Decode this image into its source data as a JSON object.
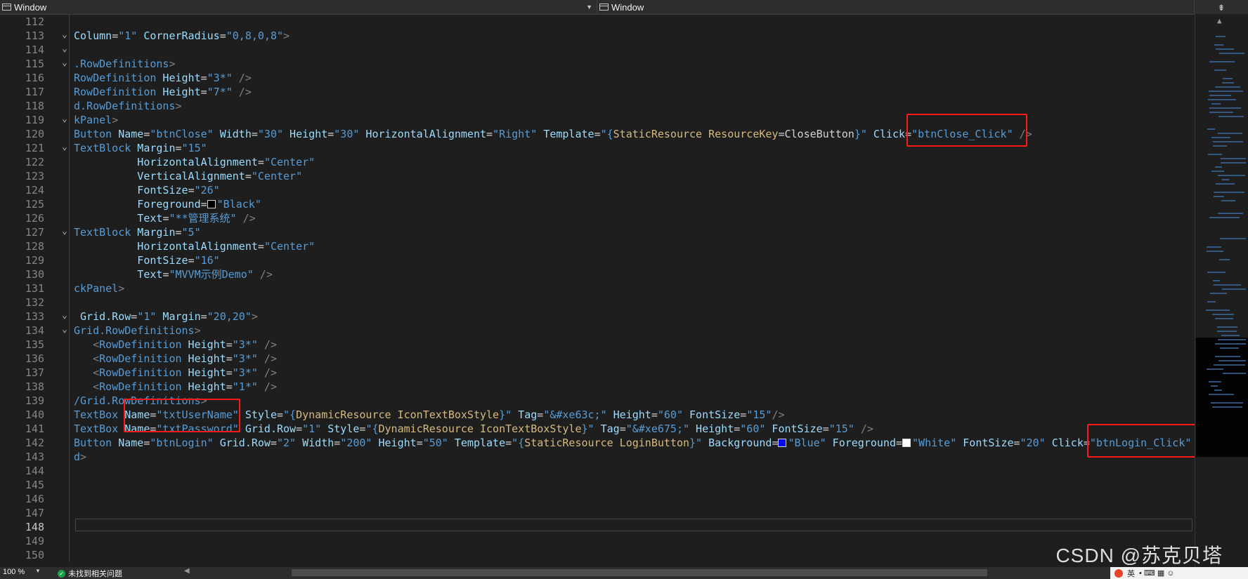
{
  "nav": {
    "left_label": "Window",
    "right_label": "Window",
    "split_glyph": "⇟"
  },
  "editor": {
    "current_line": 148,
    "lines": [
      {
        "n": "112",
        "fold": "",
        "tokens": []
      },
      {
        "n": "113",
        "fold": "⌄",
        "tokens": [
          {
            "t": "Column",
            "c": "t-attr"
          },
          {
            "t": "=",
            "c": "t-op"
          },
          {
            "t": "\"1\"",
            "c": "t-str"
          },
          {
            "t": " CornerRadius",
            "c": "t-attr"
          },
          {
            "t": "=",
            "c": "t-op"
          },
          {
            "t": "\"0,8,0,8\"",
            "c": "t-str"
          },
          {
            "t": ">",
            "c": "t-punc"
          }
        ]
      },
      {
        "n": "114",
        "fold": "⌄",
        "tokens": []
      },
      {
        "n": "115",
        "fold": "⌄",
        "tokens": [
          {
            "t": ".RowDefinitions",
            "c": "t-el"
          },
          {
            "t": ">",
            "c": "t-punc"
          }
        ]
      },
      {
        "n": "116",
        "fold": "",
        "tokens": [
          {
            "t": "RowDefinition",
            "c": "t-el"
          },
          {
            "t": " Height",
            "c": "t-attr"
          },
          {
            "t": "=",
            "c": "t-op"
          },
          {
            "t": "\"3*\"",
            "c": "t-str"
          },
          {
            "t": " />",
            "c": "t-punc"
          }
        ]
      },
      {
        "n": "117",
        "fold": "",
        "tokens": [
          {
            "t": "RowDefinition",
            "c": "t-el"
          },
          {
            "t": " Height",
            "c": "t-attr"
          },
          {
            "t": "=",
            "c": "t-op"
          },
          {
            "t": "\"7*\"",
            "c": "t-str"
          },
          {
            "t": " />",
            "c": "t-punc"
          }
        ]
      },
      {
        "n": "118",
        "fold": "",
        "tokens": [
          {
            "t": "d.RowDefinitions",
            "c": "t-el"
          },
          {
            "t": ">",
            "c": "t-punc"
          }
        ]
      },
      {
        "n": "119",
        "fold": "⌄",
        "tokens": [
          {
            "t": "kPanel",
            "c": "t-el"
          },
          {
            "t": ">",
            "c": "t-punc"
          }
        ]
      },
      {
        "n": "120",
        "fold": "",
        "tokens": [
          {
            "t": "Button",
            "c": "t-el"
          },
          {
            "t": " Name",
            "c": "t-attr"
          },
          {
            "t": "=",
            "c": "t-op"
          },
          {
            "t": "\"btnClose\"",
            "c": "t-str"
          },
          {
            "t": " Width",
            "c": "t-attr"
          },
          {
            "t": "=",
            "c": "t-op"
          },
          {
            "t": "\"30\"",
            "c": "t-str"
          },
          {
            "t": " Height",
            "c": "t-attr"
          },
          {
            "t": "=",
            "c": "t-op"
          },
          {
            "t": "\"30\"",
            "c": "t-str"
          },
          {
            "t": " HorizontalAlignment",
            "c": "t-attr"
          },
          {
            "t": "=",
            "c": "t-op"
          },
          {
            "t": "\"Right\"",
            "c": "t-str"
          },
          {
            "t": " Template",
            "c": "t-attr"
          },
          {
            "t": "=",
            "c": "t-op"
          },
          {
            "t": "\"{",
            "c": "t-str"
          },
          {
            "t": "StaticResource",
            "c": "t-ext"
          },
          {
            "t": " ResourceKey",
            "c": "t-ext"
          },
          {
            "t": "=CloseButton",
            "c": "t-plain"
          },
          {
            "t": "}\"",
            "c": "t-str"
          },
          {
            "t": " Click",
            "c": "t-attr"
          },
          {
            "t": "=",
            "c": "t-op"
          },
          {
            "t": "\"btnClose_Click\"",
            "c": "t-str"
          },
          {
            "t": " />",
            "c": "t-punc"
          }
        ]
      },
      {
        "n": "121",
        "fold": "⌄",
        "tokens": [
          {
            "t": "TextBlock",
            "c": "t-el"
          },
          {
            "t": " Margin",
            "c": "t-attr"
          },
          {
            "t": "=",
            "c": "t-op"
          },
          {
            "t": "\"15\"",
            "c": "t-str"
          }
        ]
      },
      {
        "n": "122",
        "fold": "",
        "tokens": [
          {
            "t": "          HorizontalAlignment",
            "c": "t-attr"
          },
          {
            "t": "=",
            "c": "t-op"
          },
          {
            "t": "\"Center\"",
            "c": "t-str"
          }
        ]
      },
      {
        "n": "123",
        "fold": "",
        "tokens": [
          {
            "t": "          VerticalAlignment",
            "c": "t-attr"
          },
          {
            "t": "=",
            "c": "t-op"
          },
          {
            "t": "\"Center\"",
            "c": "t-str"
          }
        ]
      },
      {
        "n": "124",
        "fold": "",
        "tokens": [
          {
            "t": "          FontSize",
            "c": "t-attr"
          },
          {
            "t": "=",
            "c": "t-op"
          },
          {
            "t": "\"26\"",
            "c": "t-str"
          }
        ]
      },
      {
        "n": "125",
        "fold": "",
        "tokens": [
          {
            "t": "          Foreground",
            "c": "t-attr"
          },
          {
            "t": "=",
            "c": "t-op"
          },
          {
            "swatch": "#000000"
          },
          {
            "t": "\"Black\"",
            "c": "t-str"
          }
        ]
      },
      {
        "n": "126",
        "fold": "",
        "tokens": [
          {
            "t": "          Text",
            "c": "t-attr"
          },
          {
            "t": "=",
            "c": "t-op"
          },
          {
            "t": "\"**管理系统\"",
            "c": "t-str"
          },
          {
            "t": " />",
            "c": "t-punc"
          }
        ]
      },
      {
        "n": "127",
        "fold": "⌄",
        "tokens": [
          {
            "t": "TextBlock",
            "c": "t-el"
          },
          {
            "t": " Margin",
            "c": "t-attr"
          },
          {
            "t": "=",
            "c": "t-op"
          },
          {
            "t": "\"5\"",
            "c": "t-str"
          }
        ]
      },
      {
        "n": "128",
        "fold": "",
        "tokens": [
          {
            "t": "          HorizontalAlignment",
            "c": "t-attr"
          },
          {
            "t": "=",
            "c": "t-op"
          },
          {
            "t": "\"Center\"",
            "c": "t-str"
          }
        ]
      },
      {
        "n": "129",
        "fold": "",
        "tokens": [
          {
            "t": "          FontSize",
            "c": "t-attr"
          },
          {
            "t": "=",
            "c": "t-op"
          },
          {
            "t": "\"16\"",
            "c": "t-str"
          }
        ]
      },
      {
        "n": "130",
        "fold": "",
        "tokens": [
          {
            "t": "          Text",
            "c": "t-attr"
          },
          {
            "t": "=",
            "c": "t-op"
          },
          {
            "t": "\"MVVM示例Demo\"",
            "c": "t-str"
          },
          {
            "t": " />",
            "c": "t-punc"
          }
        ]
      },
      {
        "n": "131",
        "fold": "",
        "tokens": [
          {
            "t": "ckPanel",
            "c": "t-el"
          },
          {
            "t": ">",
            "c": "t-punc"
          }
        ]
      },
      {
        "n": "132",
        "fold": "",
        "tokens": []
      },
      {
        "n": "133",
        "fold": "⌄",
        "tokens": [
          {
            "t": " Grid.Row",
            "c": "t-attr"
          },
          {
            "t": "=",
            "c": "t-op"
          },
          {
            "t": "\"1\"",
            "c": "t-str"
          },
          {
            "t": " Margin",
            "c": "t-attr"
          },
          {
            "t": "=",
            "c": "t-op"
          },
          {
            "t": "\"20,20\"",
            "c": "t-str"
          },
          {
            "t": ">",
            "c": "t-punc"
          }
        ]
      },
      {
        "n": "134",
        "fold": "⌄",
        "tokens": [
          {
            "t": "Grid.RowDefinitions",
            "c": "t-el"
          },
          {
            "t": ">",
            "c": "t-punc"
          }
        ]
      },
      {
        "n": "135",
        "fold": "",
        "tokens": [
          {
            "t": "   <",
            "c": "t-punc"
          },
          {
            "t": "RowDefinition",
            "c": "t-el"
          },
          {
            "t": " Height",
            "c": "t-attr"
          },
          {
            "t": "=",
            "c": "t-op"
          },
          {
            "t": "\"3*\"",
            "c": "t-str"
          },
          {
            "t": " />",
            "c": "t-punc"
          }
        ]
      },
      {
        "n": "136",
        "fold": "",
        "tokens": [
          {
            "t": "   <",
            "c": "t-punc"
          },
          {
            "t": "RowDefinition",
            "c": "t-el"
          },
          {
            "t": " Height",
            "c": "t-attr"
          },
          {
            "t": "=",
            "c": "t-op"
          },
          {
            "t": "\"3*\"",
            "c": "t-str"
          },
          {
            "t": " />",
            "c": "t-punc"
          }
        ]
      },
      {
        "n": "137",
        "fold": "",
        "tokens": [
          {
            "t": "   <",
            "c": "t-punc"
          },
          {
            "t": "RowDefinition",
            "c": "t-el"
          },
          {
            "t": " Height",
            "c": "t-attr"
          },
          {
            "t": "=",
            "c": "t-op"
          },
          {
            "t": "\"3*\"",
            "c": "t-str"
          },
          {
            "t": " />",
            "c": "t-punc"
          }
        ]
      },
      {
        "n": "138",
        "fold": "",
        "tokens": [
          {
            "t": "   <",
            "c": "t-punc"
          },
          {
            "t": "RowDefinition",
            "c": "t-el"
          },
          {
            "t": " Height",
            "c": "t-attr"
          },
          {
            "t": "=",
            "c": "t-op"
          },
          {
            "t": "\"1*\"",
            "c": "t-str"
          },
          {
            "t": " />",
            "c": "t-punc"
          }
        ]
      },
      {
        "n": "139",
        "fold": "",
        "tokens": [
          {
            "t": "/Grid.RowDefinitions",
            "c": "t-el"
          },
          {
            "t": ">",
            "c": "t-punc"
          }
        ]
      },
      {
        "n": "140",
        "fold": "",
        "tokens": [
          {
            "t": "TextBox",
            "c": "t-el"
          },
          {
            "t": " Name",
            "c": "t-attr"
          },
          {
            "t": "=",
            "c": "t-op"
          },
          {
            "t": "\"txtUserName\"",
            "c": "t-str"
          },
          {
            "t": " Style",
            "c": "t-attr"
          },
          {
            "t": "=",
            "c": "t-op"
          },
          {
            "t": "\"{",
            "c": "t-str"
          },
          {
            "t": "DynamicResource",
            "c": "t-ext"
          },
          {
            "t": " IconTextBoxStyle",
            "c": "t-ext"
          },
          {
            "t": "}\"",
            "c": "t-str"
          },
          {
            "t": " Tag",
            "c": "t-attr"
          },
          {
            "t": "=",
            "c": "t-op"
          },
          {
            "t": "\"&#xe63c;\"",
            "c": "t-str"
          },
          {
            "t": " Height",
            "c": "t-attr"
          },
          {
            "t": "=",
            "c": "t-op"
          },
          {
            "t": "\"60\"",
            "c": "t-str"
          },
          {
            "t": " FontSize",
            "c": "t-attr"
          },
          {
            "t": "=",
            "c": "t-op"
          },
          {
            "t": "\"15\"",
            "c": "t-str"
          },
          {
            "t": "/>",
            "c": "t-punc"
          }
        ]
      },
      {
        "n": "141",
        "fold": "",
        "tokens": [
          {
            "t": "TextBox",
            "c": "t-el"
          },
          {
            "t": " Name",
            "c": "t-attr"
          },
          {
            "t": "=",
            "c": "t-op"
          },
          {
            "t": "\"txtPassword\"",
            "c": "t-str"
          },
          {
            "t": " Grid.Row",
            "c": "t-attr"
          },
          {
            "t": "=",
            "c": "t-op"
          },
          {
            "t": "\"1\"",
            "c": "t-str"
          },
          {
            "t": " Style",
            "c": "t-attr"
          },
          {
            "t": "=",
            "c": "t-op"
          },
          {
            "t": "\"{",
            "c": "t-str"
          },
          {
            "t": "DynamicResource",
            "c": "t-ext"
          },
          {
            "t": " IconTextBoxStyle",
            "c": "t-ext"
          },
          {
            "t": "}\"",
            "c": "t-str"
          },
          {
            "t": " Tag",
            "c": "t-attr"
          },
          {
            "t": "=",
            "c": "t-op"
          },
          {
            "t": "\"&#xe675;\"",
            "c": "t-str"
          },
          {
            "t": " Height",
            "c": "t-attr"
          },
          {
            "t": "=",
            "c": "t-op"
          },
          {
            "t": "\"60\"",
            "c": "t-str"
          },
          {
            "t": " FontSize",
            "c": "t-attr"
          },
          {
            "t": "=",
            "c": "t-op"
          },
          {
            "t": "\"15\"",
            "c": "t-str"
          },
          {
            "t": " />",
            "c": "t-punc"
          }
        ]
      },
      {
        "n": "142",
        "fold": "",
        "tokens": [
          {
            "t": "Button",
            "c": "t-el"
          },
          {
            "t": " Name",
            "c": "t-attr"
          },
          {
            "t": "=",
            "c": "t-op"
          },
          {
            "t": "\"btnLogin\"",
            "c": "t-str"
          },
          {
            "t": " Grid.Row",
            "c": "t-attr"
          },
          {
            "t": "=",
            "c": "t-op"
          },
          {
            "t": "\"2\"",
            "c": "t-str"
          },
          {
            "t": " Width",
            "c": "t-attr"
          },
          {
            "t": "=",
            "c": "t-op"
          },
          {
            "t": "\"200\"",
            "c": "t-str"
          },
          {
            "t": " Height",
            "c": "t-attr"
          },
          {
            "t": "=",
            "c": "t-op"
          },
          {
            "t": "\"50\"",
            "c": "t-str"
          },
          {
            "t": " Template",
            "c": "t-attr"
          },
          {
            "t": "=",
            "c": "t-op"
          },
          {
            "t": "\"{",
            "c": "t-str"
          },
          {
            "t": "StaticResource",
            "c": "t-ext"
          },
          {
            "t": " LoginButton",
            "c": "t-ext"
          },
          {
            "t": "}\"",
            "c": "t-str"
          },
          {
            "t": " Background",
            "c": "t-attr"
          },
          {
            "t": "=",
            "c": "t-op"
          },
          {
            "swatch": "#0000ff"
          },
          {
            "t": "\"Blue\"",
            "c": "t-str"
          },
          {
            "t": " Foreground",
            "c": "t-attr"
          },
          {
            "t": "=",
            "c": "t-op"
          },
          {
            "swatch": "#ffffff"
          },
          {
            "t": "\"White\"",
            "c": "t-str"
          },
          {
            "t": " FontSize",
            "c": "t-attr"
          },
          {
            "t": "=",
            "c": "t-op"
          },
          {
            "t": "\"20\"",
            "c": "t-str"
          },
          {
            "t": " Click",
            "c": "t-attr"
          },
          {
            "t": "=",
            "c": "t-op"
          },
          {
            "t": "\"btnLogin_Click\"",
            "c": "t-str"
          }
        ]
      },
      {
        "n": "143",
        "fold": "",
        "tokens": [
          {
            "t": "d",
            "c": "t-el"
          },
          {
            "t": ">",
            "c": "t-punc"
          }
        ]
      },
      {
        "n": "144",
        "fold": "",
        "tokens": []
      },
      {
        "n": "145",
        "fold": "",
        "tokens": []
      },
      {
        "n": "146",
        "fold": "",
        "tokens": []
      },
      {
        "n": "147",
        "fold": "",
        "tokens": []
      },
      {
        "n": "148",
        "fold": "",
        "tokens": []
      },
      {
        "n": "149",
        "fold": "",
        "tokens": []
      },
      {
        "n": "150",
        "fold": "",
        "tokens": []
      }
    ]
  },
  "status": {
    "zoom": "100 %",
    "issues": "未找到相关问题"
  },
  "watermark": "CSDN @苏克贝塔",
  "ime": {
    "lang": "英",
    "extra": "• ⌨ ▦ ☺"
  },
  "colors": {
    "highlight_box": "#ff1a1a",
    "status_ok": "#1ba14b"
  }
}
